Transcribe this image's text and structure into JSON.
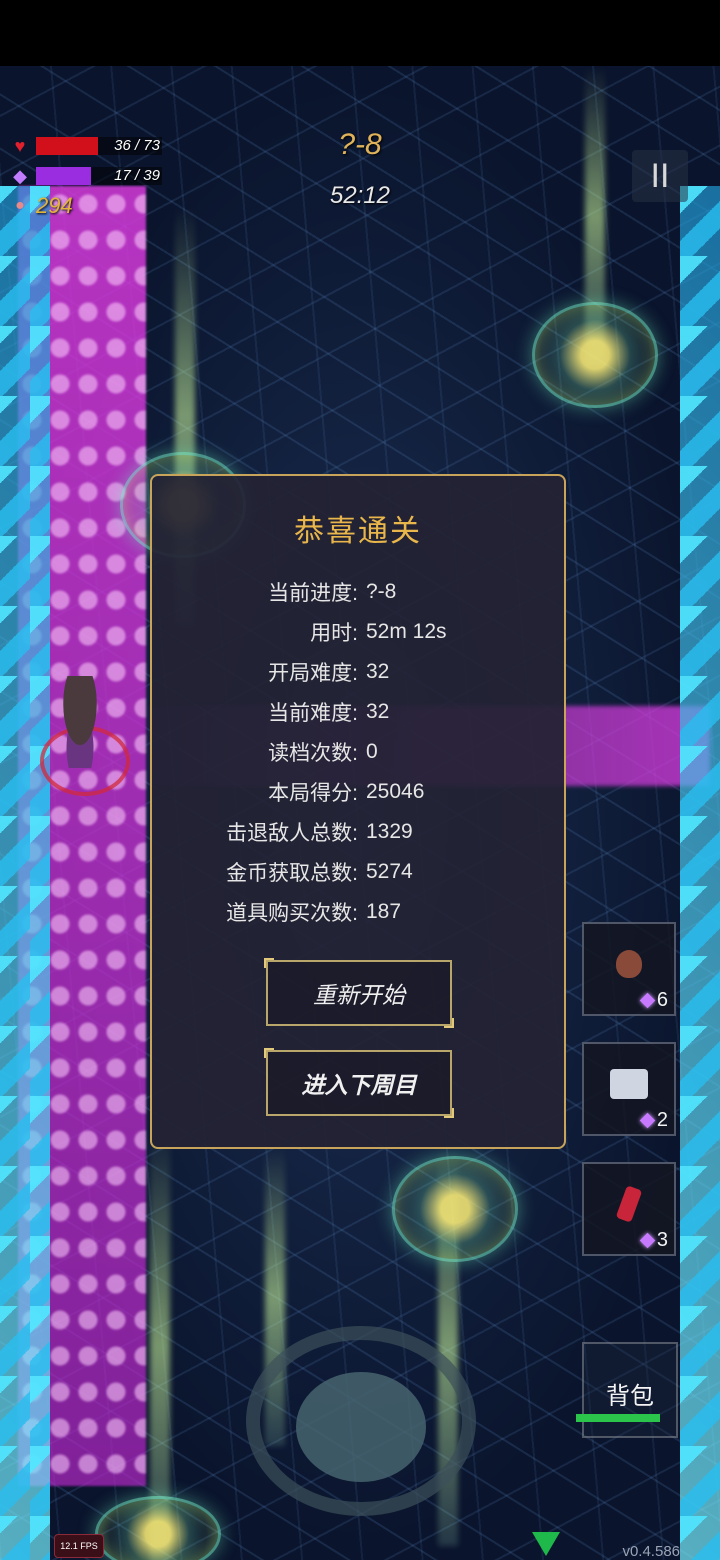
{
  "hud": {
    "hp": {
      "current": "36",
      "max": "73",
      "text": "36 / 73",
      "fraction": 0.493,
      "color": "#d2101c"
    },
    "mp": {
      "current": "17",
      "max": "39",
      "text": "17 / 39",
      "fraction": 0.436,
      "color": "#9a2de0"
    },
    "coins": "294",
    "level": "?-8",
    "timer": "52:12",
    "pause_symbol": "II"
  },
  "dialog": {
    "title": "恭喜通关",
    "stats": [
      {
        "label": "当前进度:",
        "value": "?-8"
      },
      {
        "label": "用时:",
        "value": "52m 12s"
      },
      {
        "label": "开局难度:",
        "value": "32"
      },
      {
        "label": "当前难度:",
        "value": "32"
      },
      {
        "label": "读档次数:",
        "value": "0"
      },
      {
        "label": "本局得分:",
        "value": "25046"
      },
      {
        "label": "击退敌人总数:",
        "value": "1329"
      },
      {
        "label": "金币获取总数:",
        "value": "5274"
      },
      {
        "label": "道具购买次数:",
        "value": "187"
      }
    ],
    "restart_label": "重新开始",
    "next_cycle_label": "进入下周目"
  },
  "items": [
    {
      "icon": "jar-icon",
      "count": "6"
    },
    {
      "icon": "robot-icon",
      "count": "2"
    },
    {
      "icon": "crystal-icon",
      "count": "3"
    }
  ],
  "bag_label": "背包",
  "fps": "12.1 FPS",
  "version": "v0.4.586",
  "colors": {
    "accent": "#e8b64a",
    "dialog_border": "#c8a45a"
  }
}
